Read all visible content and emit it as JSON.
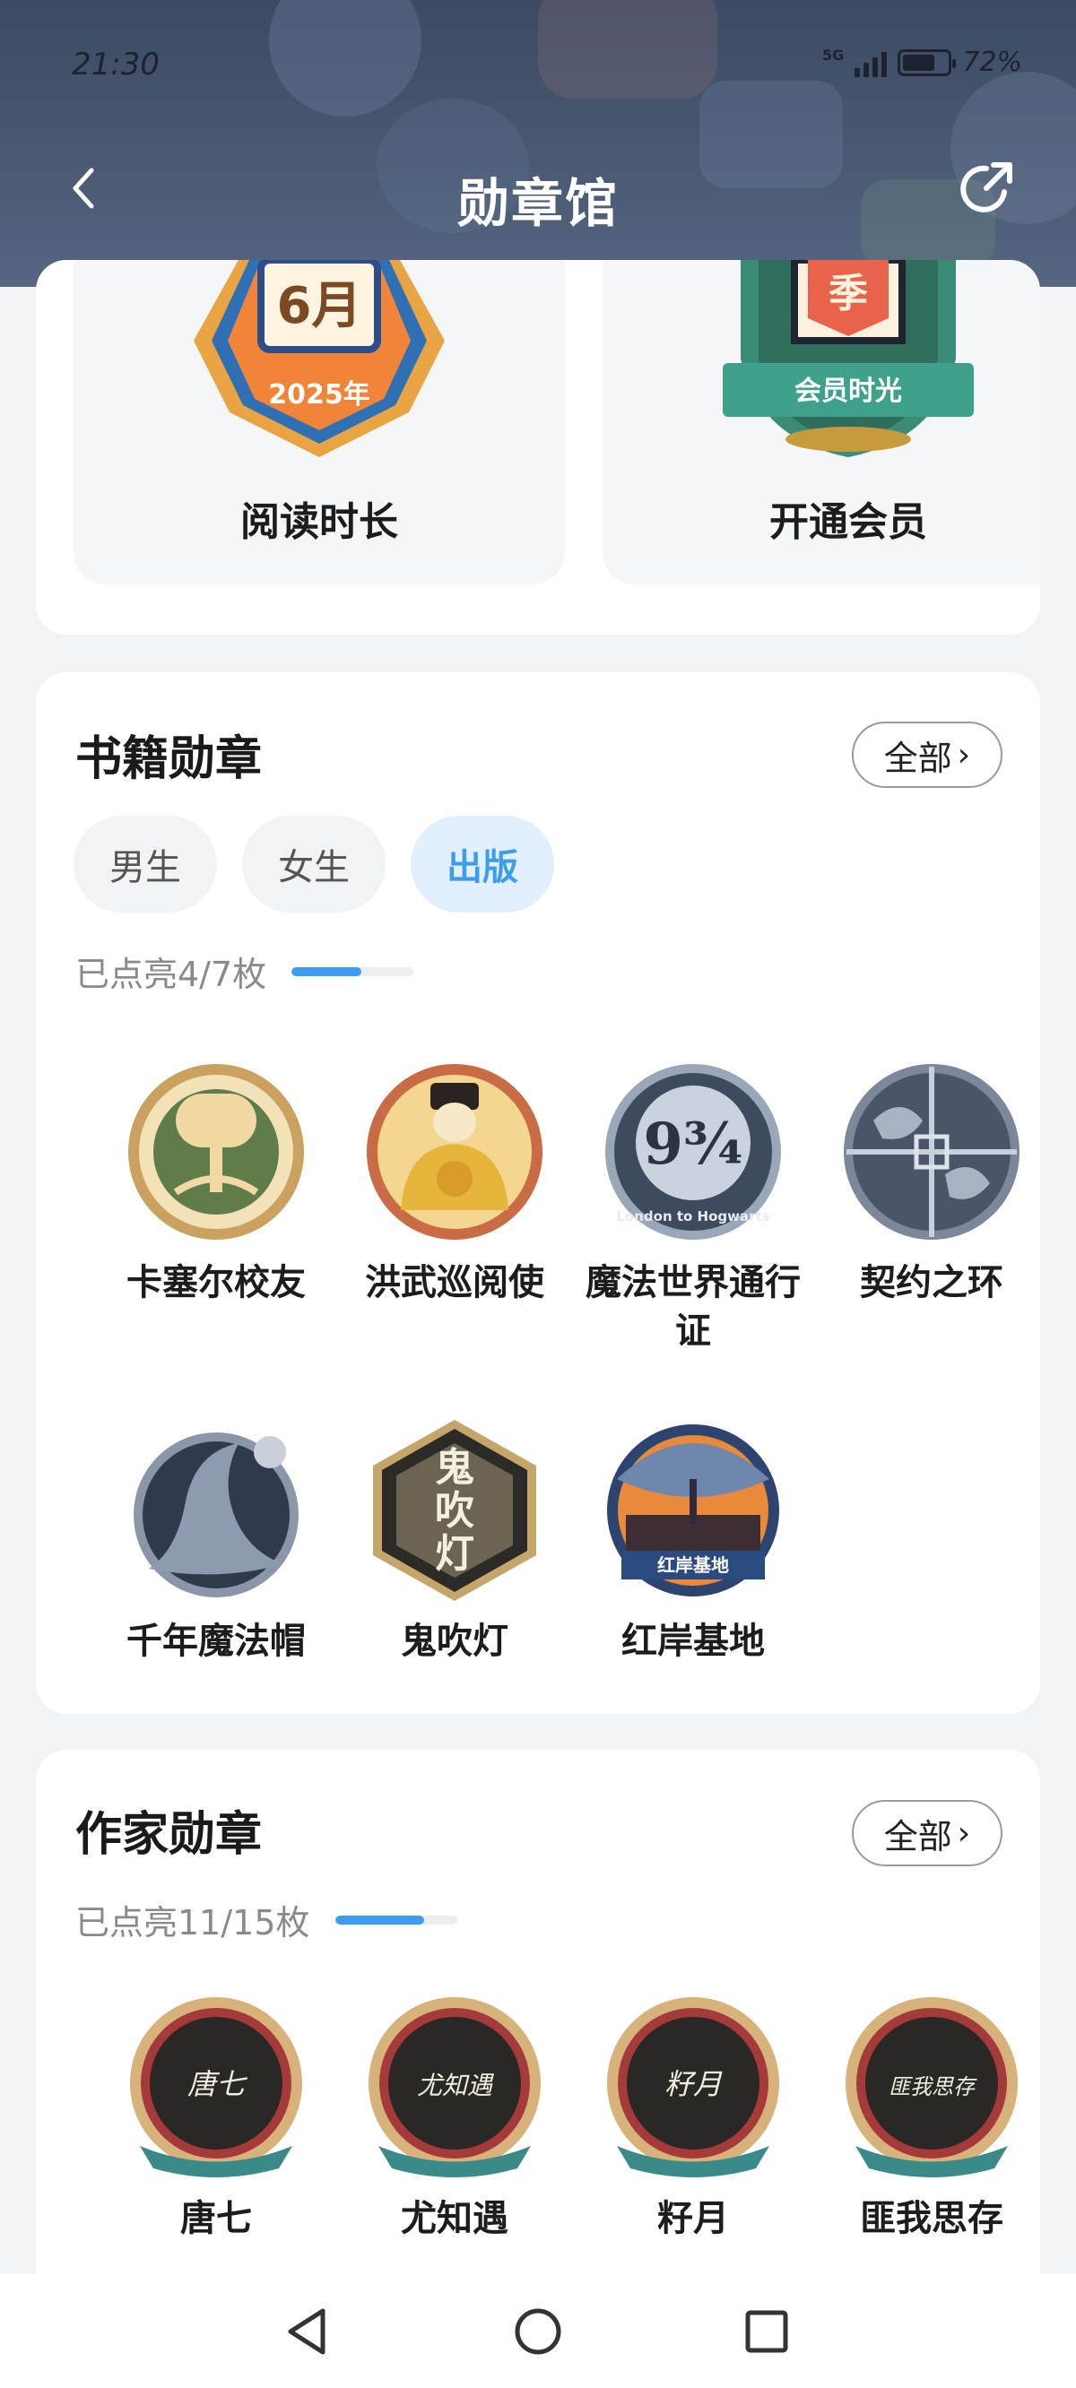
{
  "status_bar": {
    "time": "21:30",
    "network": "5G",
    "battery": "72%"
  },
  "header": {
    "title": "勋章馆"
  },
  "top_tiles": [
    {
      "name": "阅读时长",
      "badge_text": "6月",
      "badge_year": "2025年"
    },
    {
      "name": "开通会员",
      "badge_text": "季",
      "badge_ribbon": "会员时光"
    }
  ],
  "book_medals": {
    "title": "书籍勋章",
    "all_label": "全部",
    "tabs": [
      "男生",
      "女生",
      "出版"
    ],
    "active_tab": "出版",
    "progress_text": "已点亮4/7枚",
    "progress_value": 0.57,
    "items": [
      {
        "name": "卡塞尔校友",
        "icon": "tree-medal-icon"
      },
      {
        "name": "洪武巡阅使",
        "icon": "emperor-medal-icon"
      },
      {
        "name": "魔法世界通行证",
        "icon": "platform-medal-icon",
        "inner_text": "9¾",
        "ring_text": "London to Hogwarts"
      },
      {
        "name": "契约之环",
        "icon": "contract-ring-medal-icon"
      },
      {
        "name": "千年魔法帽",
        "icon": "magic-hat-medal-icon"
      },
      {
        "name": "鬼吹灯",
        "icon": "ghost-lamp-medal-icon",
        "inner_text": "鬼吹灯"
      },
      {
        "name": "红岸基地",
        "icon": "radar-base-medal-icon",
        "inner_text": "红岸基地"
      }
    ]
  },
  "author_medals": {
    "title": "作家勋章",
    "all_label": "全部",
    "progress_text": "已点亮11/15枚",
    "progress_value": 0.73,
    "items": [
      {
        "name": "唐七",
        "signature": "唐七"
      },
      {
        "name": "尤知遇",
        "signature": "尤知遇"
      },
      {
        "name": "籽月",
        "signature": "籽月"
      },
      {
        "name": "匪我思存",
        "signature": "匪我思存"
      }
    ]
  },
  "colors": {
    "accent": "#3d9df0",
    "header_bg": "#4a5872",
    "chip_active_bg": "#e2f0fd"
  }
}
